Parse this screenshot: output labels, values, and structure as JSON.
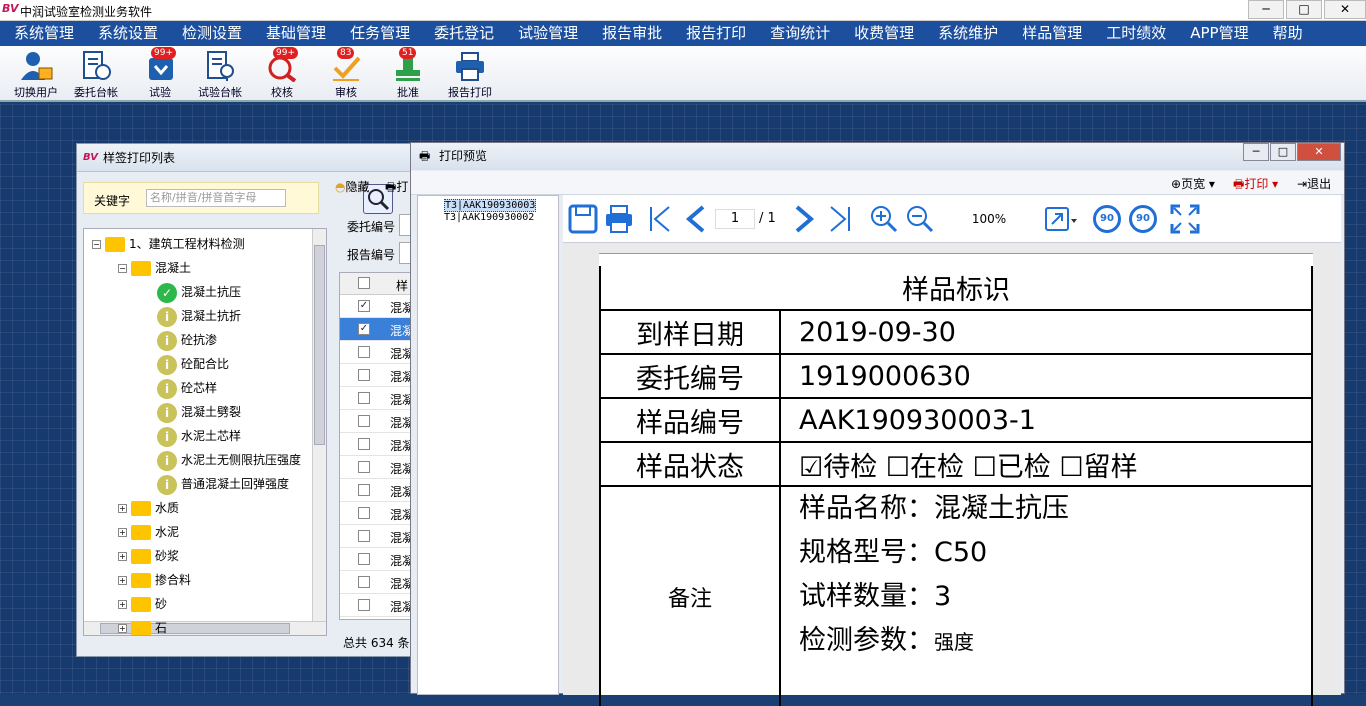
{
  "app": {
    "title": "中润试验室检测业务软件",
    "logo": "BV"
  },
  "window_controls": {
    "min": "─",
    "max": "□",
    "close": "✕"
  },
  "menu": [
    "系统管理",
    "系统设置",
    "检测设置",
    "基础管理",
    "任务管理",
    "委托登记",
    "试验管理",
    "报告审批",
    "报告打印",
    "查询统计",
    "收费管理",
    "系统维护",
    "样品管理",
    "工时绩效",
    "APP管理",
    "帮助"
  ],
  "toolbar": [
    {
      "label": "切换用户",
      "icon": "user-switch-icon",
      "badge": ""
    },
    {
      "label": "委托台帐",
      "icon": "ledger-icon",
      "badge": ""
    },
    {
      "label": "试验",
      "icon": "test-icon",
      "badge": "99+"
    },
    {
      "label": "试验台帐",
      "icon": "test-ledger-icon",
      "badge": ""
    },
    {
      "label": "校核",
      "icon": "check-icon",
      "badge": "99+"
    },
    {
      "label": "审核",
      "icon": "review-icon",
      "badge": "83"
    },
    {
      "label": "批准",
      "icon": "approve-icon",
      "badge": "51"
    },
    {
      "label": "报告打印",
      "icon": "printer-icon",
      "badge": ""
    }
  ],
  "label_window": {
    "title": "样签打印列表",
    "keyword_label": "关键字",
    "keyword_placeholder": "名称/拼音/拼音首字母",
    "hide_label": "隐藏",
    "print_short": "打",
    "wt_label": "委托编号",
    "report_label": "报告编号",
    "col_sample": "样",
    "row_text": "混凝",
    "total": "总共 634 条",
    "tree": [
      {
        "label": "1、建筑工程材料检测",
        "level": 0,
        "type": "folder",
        "exp": "−"
      },
      {
        "label": "混凝土",
        "level": 1,
        "type": "folder",
        "exp": "−"
      },
      {
        "label": "混凝土抗压",
        "level": 2,
        "type": "check"
      },
      {
        "label": "混凝土抗折",
        "level": 2,
        "type": "info"
      },
      {
        "label": "砼抗渗",
        "level": 2,
        "type": "info"
      },
      {
        "label": "砼配合比",
        "level": 2,
        "type": "info"
      },
      {
        "label": "砼芯样",
        "level": 2,
        "type": "info"
      },
      {
        "label": "混凝土劈裂",
        "level": 2,
        "type": "info"
      },
      {
        "label": "水泥土芯样",
        "level": 2,
        "type": "info"
      },
      {
        "label": "水泥土无侧限抗压强度",
        "level": 2,
        "type": "info"
      },
      {
        "label": "普通混凝土回弹强度",
        "level": 2,
        "type": "info"
      },
      {
        "label": "水质",
        "level": 1,
        "type": "folder",
        "exp": "+"
      },
      {
        "label": "水泥",
        "level": 1,
        "type": "folder",
        "exp": "+"
      },
      {
        "label": "砂浆",
        "level": 1,
        "type": "folder",
        "exp": "+"
      },
      {
        "label": "掺合料",
        "level": 1,
        "type": "folder",
        "exp": "+"
      },
      {
        "label": "砂",
        "level": 1,
        "type": "folder",
        "exp": "+"
      },
      {
        "label": "石",
        "level": 1,
        "type": "folder",
        "exp": "+"
      }
    ],
    "rows_checked": [
      true,
      true,
      false,
      false,
      false,
      false,
      false,
      false,
      false,
      false,
      false,
      false,
      false,
      false
    ]
  },
  "preview": {
    "title": "打印预览",
    "page_view": "页宽",
    "print": "打印",
    "exit": "退出",
    "list": [
      "T3|AAK190930003",
      "T3|AAK190930002"
    ],
    "page_current": "1",
    "page_total": "/ 1",
    "zoom": "100%",
    "rotate_left": "90",
    "rotate_right": "90"
  },
  "label": {
    "heading": "样品标识",
    "arrival_date_label": "到样日期",
    "arrival_date": "2019-09-30",
    "commission_label": "委托编号",
    "commission_no": "1919000630",
    "sample_no_label": "样品编号",
    "sample_no": "AAK190930003-1",
    "status_label": "样品状态",
    "status": "☑待检 ☐在检 ☐已检 ☐留样",
    "remark_label": "备注",
    "remarks": [
      "样品名称：混凝土抗压",
      "规格型号：C50",
      "试样数量：3"
    ],
    "param_label": "检测参数：",
    "param_value": "强度"
  },
  "colors": {
    "menubar": "#1c4f9e",
    "desktop": "#163a6e",
    "accent_blue": "#1f6fd6",
    "badge": "#e02020"
  }
}
